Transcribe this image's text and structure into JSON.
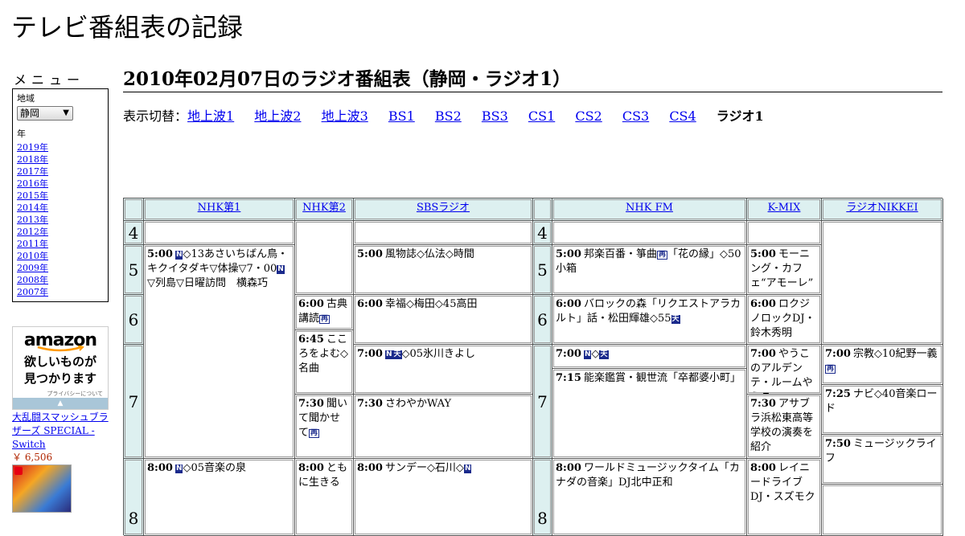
{
  "site_title": "テレビ番組表の記録",
  "menu": {
    "heading": "メニュー",
    "region_label": "地域",
    "region_value": "静岡",
    "year_label": "年",
    "years": [
      "2019年",
      "2018年",
      "2017年",
      "2016年",
      "2015年",
      "2014年",
      "2013年",
      "2012年",
      "2011年",
      "2010年",
      "2009年",
      "2008年",
      "2007年"
    ]
  },
  "ad": {
    "logo": "amazon",
    "text_line1": "欲しいものが",
    "text_line2": "見つかります",
    "privacy": "プライバシーについて",
    "product_title": "大乱闘スマッシュブラザーズ SPECIAL - Switch",
    "product_price": "￥ 6,506"
  },
  "page_title": "2010年02月07日のラジオ番組表（静岡・ラジオ1）",
  "switcher": {
    "label": "表示切替：",
    "links": [
      "地上波1",
      "地上波2",
      "地上波3",
      "BS1",
      "BS2",
      "BS3",
      "CS1",
      "CS2",
      "CS3",
      "CS4"
    ],
    "current": "ラジオ1"
  },
  "channels": [
    "NHK第1",
    "NHK第2",
    "SBSラジオ",
    "NHK FM",
    "K-MIX",
    "ラジオNIKKEI"
  ],
  "hours": [
    "4",
    "5",
    "6",
    "7",
    "8"
  ],
  "programs": {
    "nhk1_0500": {
      "time": "5:00",
      "b1": "N",
      "t1": "◇13あさいちばん鳥・キクイタダキ▽体操▽7・00",
      "b2": "N",
      "t2": "▽列島▽日曜訪問　横森巧"
    },
    "nhk1_0800": {
      "time": "8:00",
      "b1": "N",
      "t1": "◇05音楽の泉"
    },
    "nhk2_0600": {
      "time": "6:00",
      "t1": "古典講読",
      "b1": "再"
    },
    "nhk2_0645": {
      "time": "6:45",
      "t1": "こころをよむ◇名曲"
    },
    "nhk2_0730": {
      "time": "7:30",
      "t1": "聞いて聞かせて",
      "b1": "再"
    },
    "nhk2_0800": {
      "time": "8:00",
      "t1": "ともに生きる"
    },
    "sbs_0500": {
      "time": "5:00",
      "t1": "風物誌◇仏法◇時間"
    },
    "sbs_0600": {
      "time": "6:00",
      "t1": "幸福◇梅田◇45高田"
    },
    "sbs_0700": {
      "time": "7:00",
      "b1": "N",
      "b2": "天",
      "t1": "◇05氷川きよし"
    },
    "sbs_0730": {
      "time": "7:30",
      "t1": "さわやかWAY"
    },
    "sbs_0800": {
      "time": "8:00",
      "t1": "サンデー◇石川◇",
      "b1": "N"
    },
    "fm_0500": {
      "time": "5:00",
      "t1": "邦楽百番・箏曲",
      "b1": "再",
      "t2": "「花の縁」◇50小箱"
    },
    "fm_0600": {
      "time": "6:00",
      "t1": "バロックの森「リクエストアラカルト」話・松田輝雄◇55",
      "b1": "天"
    },
    "fm_0700": {
      "time": "7:00",
      "b1": "N",
      "t1": "◇",
      "b2": "天"
    },
    "fm_0715": {
      "time": "7:15",
      "t1": "能楽鑑賞・観世流「卒都婆小町」"
    },
    "fm_0800": {
      "time": "8:00",
      "t1": "ワールドミュージックタイム「カナダの音楽」DJ北中正和"
    },
    "kmix_0500": {
      "time": "5:00",
      "t1": "モーニング・カフェ“アモーレ”"
    },
    "kmix_0600": {
      "time": "6:00",
      "t1": "ロクジノロックDJ・鈴木秀明"
    },
    "kmix_0700": {
      "time": "7:00",
      "t1": "やうこのアルデンテ・ルームやうこ"
    },
    "kmix_0730": {
      "time": "7:30",
      "t1": "アサブラ浜松東高等学校の演奏を紹介"
    },
    "kmix_0800": {
      "time": "8:00",
      "t1": "レイニードライブDJ・スズモク"
    },
    "nikkei_0700": {
      "time": "7:00",
      "t1": "宗教◇10紀野一義",
      "b1": "再"
    },
    "nikkei_0725": {
      "time": "7:25",
      "t1": "ナビ◇40音楽ロード"
    },
    "nikkei_0750": {
      "time": "7:50",
      "t1": "ミュージックライフ"
    }
  }
}
